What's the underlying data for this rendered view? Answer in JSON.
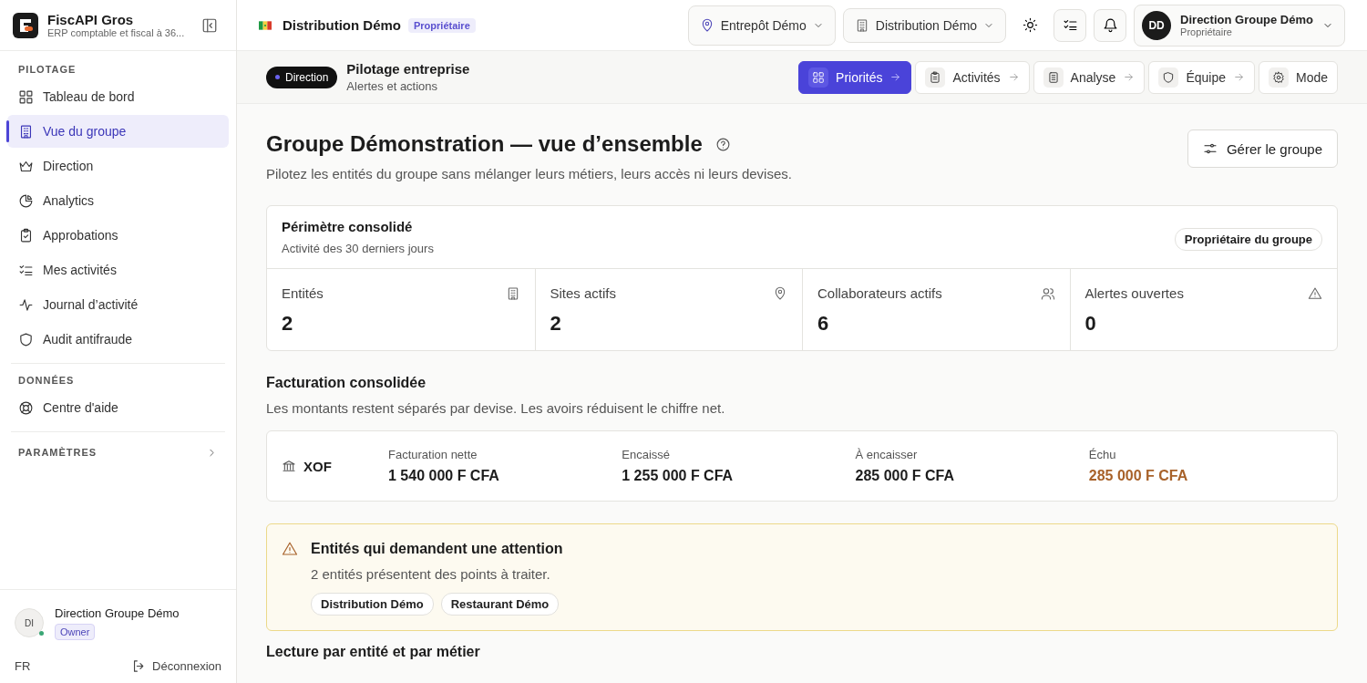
{
  "sidebar": {
    "app_name": "FiscAPI Gros",
    "app_subtitle": "ERP comptable et fiscal à 36...",
    "sections": [
      {
        "title": "PILOTAGE",
        "items": [
          {
            "label": "Tableau de bord",
            "selected": false
          },
          {
            "label": "Vue du groupe",
            "selected": true
          },
          {
            "label": "Direction",
            "selected": false
          },
          {
            "label": "Analytics",
            "selected": false
          },
          {
            "label": "Approbations",
            "selected": false
          },
          {
            "label": "Mes activités",
            "selected": false
          },
          {
            "label": "Journal d’activité",
            "selected": false
          },
          {
            "label": "Audit antifraude",
            "selected": false
          }
        ]
      },
      {
        "title": "DONNÉES",
        "items": [
          {
            "label": "Centre d'aide",
            "selected": false
          }
        ]
      }
    ],
    "settings": {
      "title": "PARAMÈTRES",
      "expanded": false
    },
    "user": {
      "initials": "DI",
      "name": "Direction Groupe Démo",
      "role": "Owner",
      "online": true
    },
    "language": "FR",
    "logout": "Déconnexion"
  },
  "header": {
    "entity": "Distribution Démo",
    "entity_role": "Propriétaire",
    "warehouse": "Entrepôt Démo",
    "company": "Distribution Démo",
    "user": {
      "initials": "DD",
      "name": "Direction Groupe Démo",
      "role": "Propriétaire"
    }
  },
  "subheader": {
    "badge": "Direction",
    "title": "Pilotage entreprise",
    "subtitle": "Alertes et actions",
    "tabs": [
      {
        "label": "Priorités",
        "selected": true,
        "arrow": true
      },
      {
        "label": "Activités",
        "selected": false,
        "arrow": true
      },
      {
        "label": "Analyse",
        "selected": false,
        "arrow": true
      },
      {
        "label": "Équipe",
        "selected": false,
        "arrow": true
      },
      {
        "label": "Mode",
        "selected": false,
        "arrow": false
      }
    ]
  },
  "page": {
    "title": "Groupe Démonstration — vue d’ensemble",
    "description": "Pilotez les entités du groupe sans mélanger leurs métiers, leurs accès ni leurs devises.",
    "manage_button": "Gérer le groupe"
  },
  "perimeter": {
    "title": "Périmètre consolidé",
    "subtitle": "Activité des 30 derniers jours",
    "badge": "Propriétaire du groupe",
    "stats": [
      {
        "label": "Entités",
        "value": "2"
      },
      {
        "label": "Sites actifs",
        "value": "2"
      },
      {
        "label": "Collaborateurs actifs",
        "value": "6"
      },
      {
        "label": "Alertes ouvertes",
        "value": "0"
      }
    ]
  },
  "billing": {
    "title": "Facturation consolidée",
    "description": "Les montants restent séparés par devise. Les avoirs réduisent le chiffre net.",
    "currency": "XOF",
    "amounts": [
      {
        "label": "Facturation nette",
        "value": "1 540 000 F CFA",
        "overdue": false
      },
      {
        "label": "Encaissé",
        "value": "1 255 000 F CFA",
        "overdue": false
      },
      {
        "label": "À encaisser",
        "value": "285 000 F CFA",
        "overdue": false
      },
      {
        "label": "Échu",
        "value": "285 000 F CFA",
        "overdue": true
      }
    ]
  },
  "attention": {
    "title": "Entités qui demandent une attention",
    "text": "2 entités présentent des points à traiter.",
    "entities": [
      "Distribution Démo",
      "Restaurant Démo"
    ]
  },
  "next_section": {
    "title": "Lecture par entité et par métier"
  }
}
